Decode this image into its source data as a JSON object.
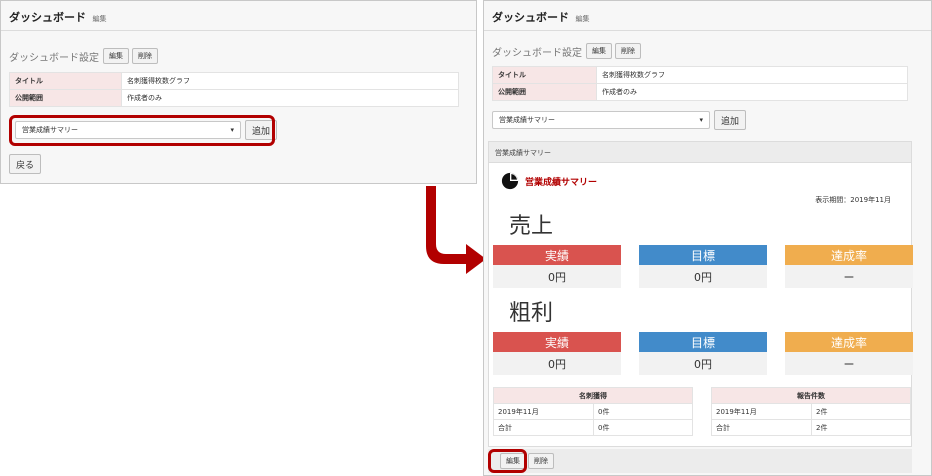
{
  "left": {
    "header_title": "ダッシュボード",
    "header_sub": "編集",
    "settings_label": "ダッシュボード設定",
    "edit_button": "編集",
    "delete_button": "削除",
    "info": [
      {
        "key": "タイトル",
        "value": "名刺獲得枚数グラフ"
      },
      {
        "key": "公開範囲",
        "value": "作成者のみ"
      }
    ],
    "select_value": "営業成績サマリー",
    "add_button": "追加",
    "back_button": "戻る"
  },
  "right": {
    "header_title": "ダッシュボード",
    "header_sub": "編集",
    "settings_label": "ダッシュボード設定",
    "edit_button": "編集",
    "delete_button": "削除",
    "info": [
      {
        "key": "タイトル",
        "value": "名刺獲得枚数グラフ"
      },
      {
        "key": "公開範囲",
        "value": "作成者のみ"
      }
    ],
    "select_value": "営業成績サマリー",
    "add_button": "追加",
    "summary_header": "営業成績サマリー",
    "card_title": "営業成績サマリー",
    "period": "表示期間：2019年11月",
    "sales_label": "売上",
    "profit_label": "粗利",
    "metrics_labels": [
      "実績",
      "目標",
      "達成率"
    ],
    "sales_values": [
      "0円",
      "0円",
      "ー"
    ],
    "profit_values": [
      "0円",
      "0円",
      "ー"
    ],
    "table1": {
      "header": "名刺獲得",
      "rows": [
        [
          "2019年11月",
          "0件"
        ],
        [
          "合計",
          "0件"
        ]
      ]
    },
    "table2": {
      "header": "報告件数",
      "rows": [
        [
          "2019年11月",
          "2件"
        ],
        [
          "合計",
          "2件"
        ]
      ]
    },
    "bottom_edit": "編集",
    "bottom_delete": "削除"
  },
  "colors": {
    "actual": "#d9534f",
    "target": "#428bca",
    "rate": "#f0ad4e",
    "highlight": "#b20000"
  }
}
